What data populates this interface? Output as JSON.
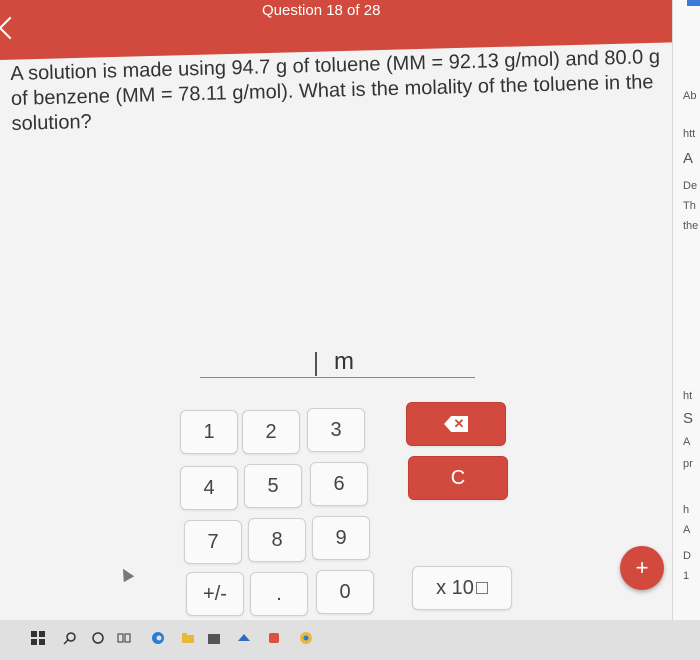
{
  "header": {
    "title": "Question 18 of 28"
  },
  "question": {
    "text": "A solution is made using 94.7 g of toluene (MM = 92.13 g/mol) and 80.0 g of benzene (MM = 78.11 g/mol). What is the molality of the toluene in the solution?"
  },
  "answer": {
    "unit": "m"
  },
  "keypad": {
    "digits": [
      "1",
      "2",
      "3",
      "4",
      "5",
      "6",
      "7",
      "8",
      "9",
      "0"
    ],
    "plusminus": "+/-",
    "decimal": ".",
    "clear": "C",
    "x10": "x 10"
  },
  "fab": {
    "label": "+"
  },
  "side": {
    "items": [
      "Ab",
      "htt",
      "A",
      "De",
      "Th",
      "the",
      "ht",
      "S",
      "A",
      "pr",
      "h",
      "A",
      "D",
      "1"
    ]
  },
  "colors": {
    "accent": "#d24a3e"
  }
}
